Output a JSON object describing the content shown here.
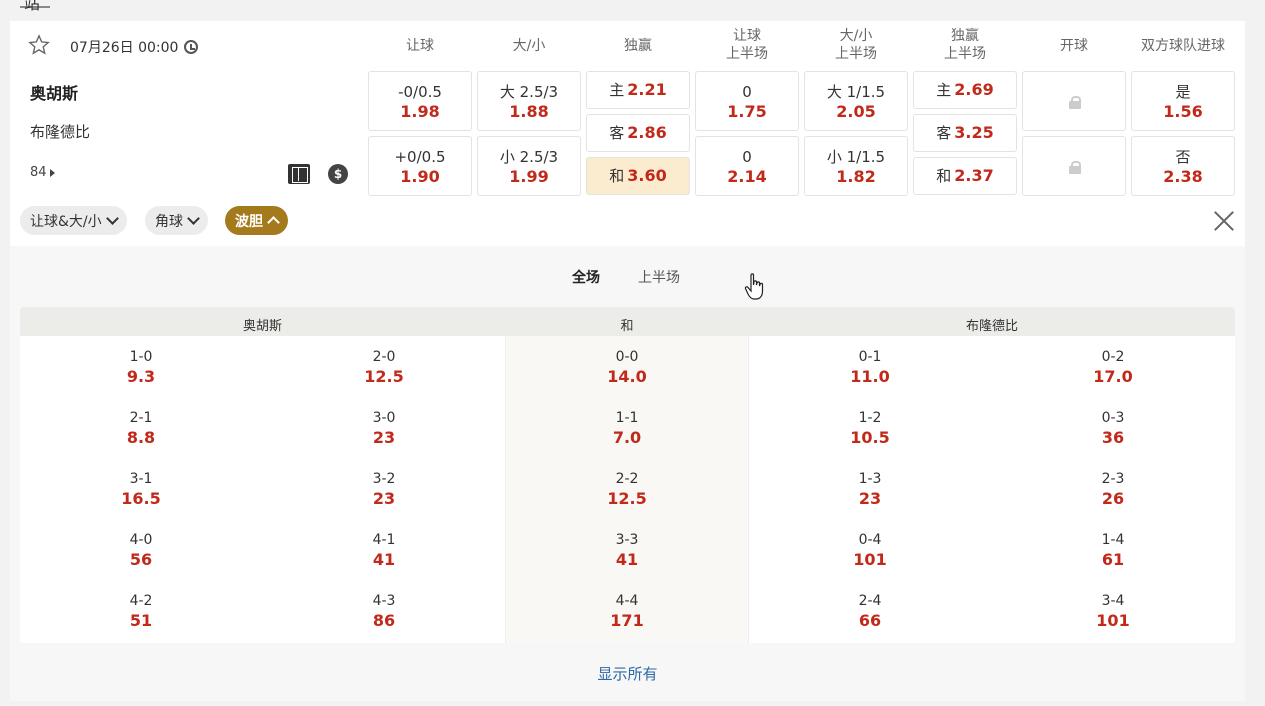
{
  "header_fragment": "站",
  "match": {
    "datetime": "07月26日 00:00",
    "home": "奥胡斯",
    "away": "布隆德比",
    "more_count": "84"
  },
  "columns": [
    {
      "l1": "让球",
      "l2": ""
    },
    {
      "l1": "大/小",
      "l2": ""
    },
    {
      "l1": "独赢",
      "l2": ""
    },
    {
      "l1": "让球",
      "l2": "上半场"
    },
    {
      "l1": "大/小",
      "l2": "上半场"
    },
    {
      "l1": "独赢",
      "l2": "上半场"
    },
    {
      "l1": "开球",
      "l2": ""
    },
    {
      "l1": "双方球队进球",
      "l2": ""
    }
  ],
  "markets": {
    "handicap": [
      {
        "label": "-0/0.5",
        "odd": "1.98"
      },
      {
        "label": "+0/0.5",
        "odd": "1.90"
      }
    ],
    "overunder": [
      {
        "label": "大 2.5/3",
        "odd": "1.88"
      },
      {
        "label": "小 2.5/3",
        "odd": "1.99"
      }
    ],
    "moneyline": [
      {
        "label": "主",
        "odd": "2.21"
      },
      {
        "label": "客",
        "odd": "2.86"
      },
      {
        "label": "和",
        "odd": "3.60"
      }
    ],
    "handicap_1h": [
      {
        "label": "0",
        "odd": "1.75"
      },
      {
        "label": "0",
        "odd": "2.14"
      }
    ],
    "overunder_1h": [
      {
        "label": "大 1/1.5",
        "odd": "2.05"
      },
      {
        "label": "小 1/1.5",
        "odd": "1.82"
      }
    ],
    "moneyline_1h": [
      {
        "label": "主",
        "odd": "2.69"
      },
      {
        "label": "客",
        "odd": "3.25"
      },
      {
        "label": "和",
        "odd": "2.37"
      }
    ],
    "btts": [
      {
        "label": "是",
        "odd": "1.56"
      },
      {
        "label": "否",
        "odd": "2.38"
      }
    ]
  },
  "filters": [
    {
      "label": "让球&大/小"
    },
    {
      "label": "角球"
    },
    {
      "label": "波胆"
    }
  ],
  "panel": {
    "tabs": [
      "全场",
      "上半场"
    ],
    "headers": [
      "奥胡斯",
      "和",
      "布隆德比"
    ],
    "show_all": "显示所有",
    "scores": [
      [
        {
          "s": "1-0",
          "o": "9.3"
        },
        {
          "s": "2-0",
          "o": "12.5"
        },
        {
          "s": "0-0",
          "o": "14.0"
        },
        {
          "s": "0-1",
          "o": "11.0"
        },
        {
          "s": "0-2",
          "o": "17.0"
        }
      ],
      [
        {
          "s": "2-1",
          "o": "8.8"
        },
        {
          "s": "3-0",
          "o": "23"
        },
        {
          "s": "1-1",
          "o": "7.0"
        },
        {
          "s": "1-2",
          "o": "10.5"
        },
        {
          "s": "0-3",
          "o": "36"
        }
      ],
      [
        {
          "s": "3-1",
          "o": "16.5"
        },
        {
          "s": "3-2",
          "o": "23"
        },
        {
          "s": "2-2",
          "o": "12.5"
        },
        {
          "s": "1-3",
          "o": "23"
        },
        {
          "s": "2-3",
          "o": "26"
        }
      ],
      [
        {
          "s": "4-0",
          "o": "56"
        },
        {
          "s": "4-1",
          "o": "41"
        },
        {
          "s": "3-3",
          "o": "41"
        },
        {
          "s": "0-4",
          "o": "101"
        },
        {
          "s": "1-4",
          "o": "61"
        }
      ],
      [
        {
          "s": "4-2",
          "o": "51"
        },
        {
          "s": "4-3",
          "o": "86"
        },
        {
          "s": "4-4",
          "o": "171"
        },
        {
          "s": "2-4",
          "o": "66"
        },
        {
          "s": "3-4",
          "o": "101"
        }
      ]
    ]
  }
}
